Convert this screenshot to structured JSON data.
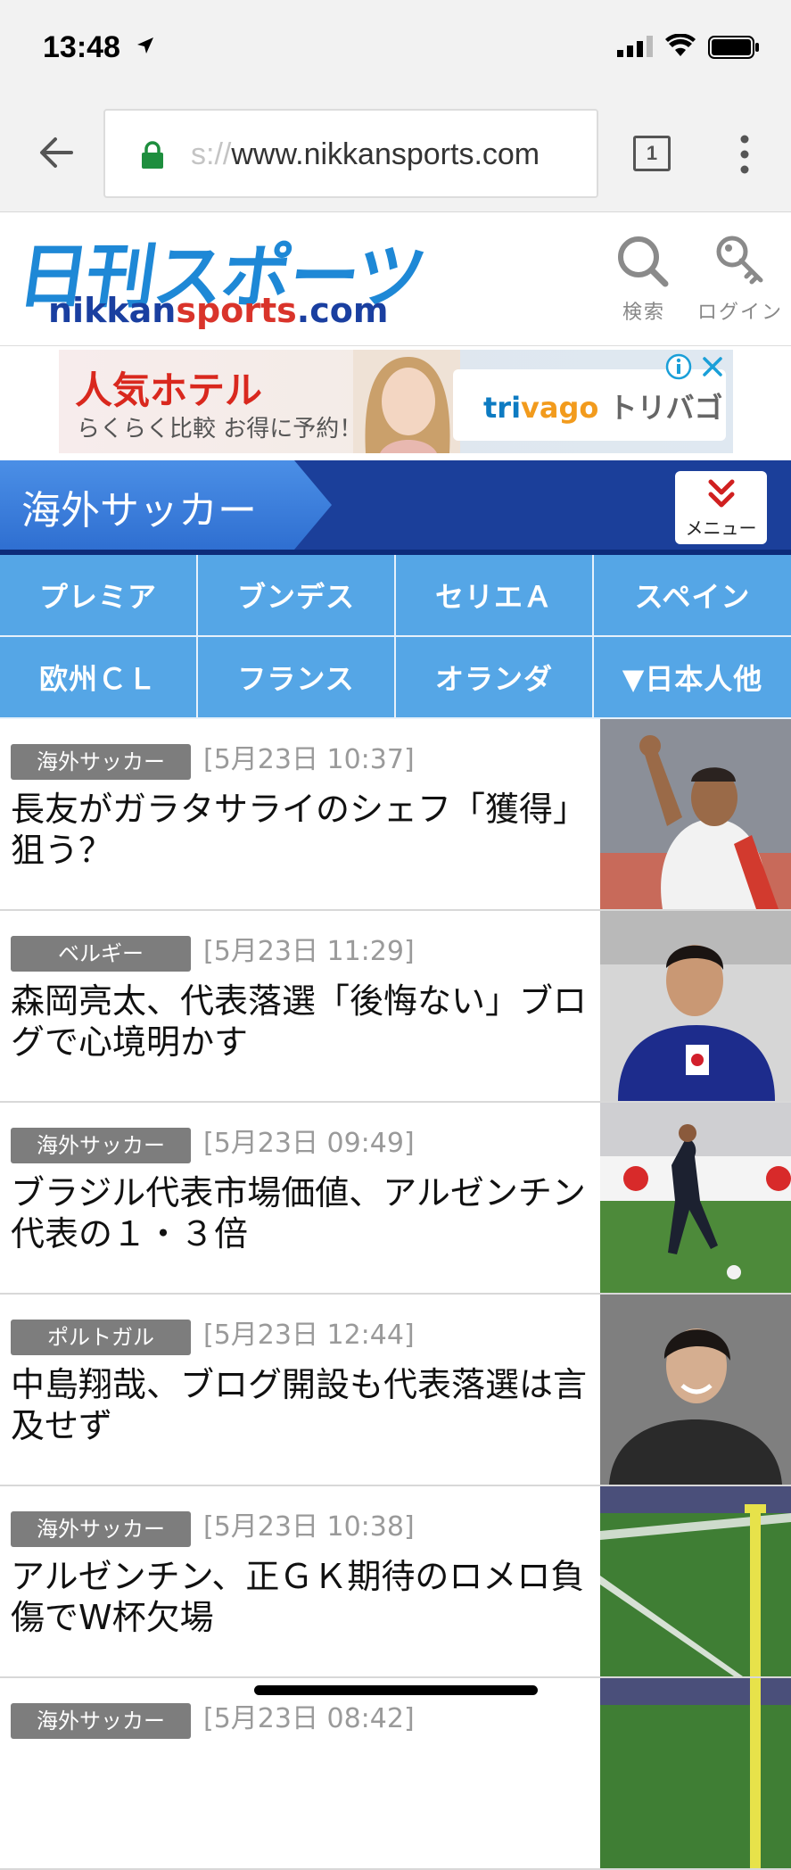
{
  "status_bar": {
    "time": "13:48"
  },
  "browser": {
    "url_faded": "s://",
    "url_main": "www.nikkansports.com",
    "tab_count": "1"
  },
  "header": {
    "logo_jp": "日刊スポーツ",
    "logo_en_part1": "nikkan",
    "logo_en_part2": "sports",
    "logo_en_part3": ".com",
    "search_label": "検索",
    "login_label": "ログイン"
  },
  "ad": {
    "title": "人気ホテル",
    "subtitle": "らくらく比較 お得に予約！",
    "brand_part1": "tri",
    "brand_part2": "vago",
    "brand_part3": " トリバゴ"
  },
  "section": {
    "title": "海外サッカー",
    "menu_label": "メニュー"
  },
  "nav": [
    "プレミア",
    "ブンデス",
    "セリエＡ",
    "スペイン",
    "欧州ＣＬ",
    "フランス",
    "オランダ",
    "▼日本人他"
  ],
  "articles": [
    {
      "category": "海外サッカー",
      "date": "[5月23日 10:37]",
      "headline": "長友がガラタサライのシェフ「獲得」狙う？"
    },
    {
      "category": "ベルギー",
      "date": "[5月23日 11:29]",
      "headline": "森岡亮太、代表落選「後悔ない」ブログで心境明かす"
    },
    {
      "category": "海外サッカー",
      "date": "[5月23日 09:49]",
      "headline": "ブラジル代表市場価値、アルゼンチン代表の１・３倍"
    },
    {
      "category": "ポルトガル",
      "date": "[5月23日 12:44]",
      "headline": "中島翔哉、ブログ開設も代表落選は言及せず"
    },
    {
      "category": "海外サッカー",
      "date": "[5月23日 10:38]",
      "headline": "アルゼンチン、正ＧＫ期待のロメロ負傷でW杯欠場"
    },
    {
      "category": "海外サッカー",
      "date": "[5月23日 08:42]",
      "headline": ""
    }
  ]
}
